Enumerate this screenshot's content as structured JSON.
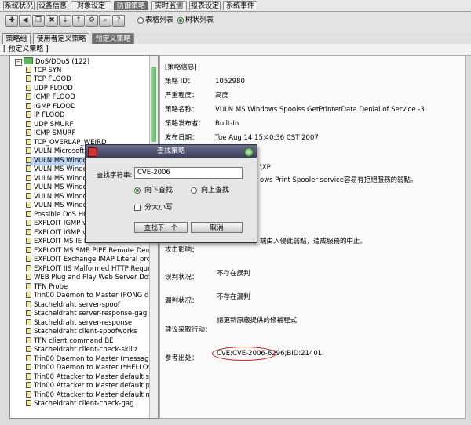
{
  "top_tabs": [
    "系统状况",
    "设备信息",
    "对象设定",
    "防御策略",
    "实时监测",
    "报表设定",
    "系统事件"
  ],
  "toolbar": {
    "view_options": [
      {
        "label": "表格列表",
        "selected": false
      },
      {
        "label": "树状列表",
        "selected": true
      }
    ]
  },
  "sub_tabs": [
    "策略组",
    "使用者定义策略",
    "预定义策略"
  ],
  "breadcrumb": "[ 预定义策略 ]",
  "tree": {
    "root_label": "DoS/DDoS (122)",
    "items": [
      "TCP SYN",
      "TCP FLOOD",
      "UDP FLOOD",
      "ICMP FLOOD",
      "IGMP FLOOD",
      "IP FLOOD",
      "UDP SMURF",
      "ICMP SMURF",
      "TCP_OVERLAP_WEIRD",
      "VULN Microsoft E",
      "VULN MS Window",
      "VULN MS Window",
      "VULN MS Window",
      "VULN MS Window",
      "VULN MS Window",
      "VULN MS Window",
      "Possible DoS HO",
      "EXPLOIT IGMP v3",
      "EXPLOIT IGMP v3",
      "EXPLOIT MS IE H",
      "EXPLOIT MS SMB PIPE Remote Denial o",
      "EXPLOIT Exchange IMAP Literal process",
      "EXPLOIT IIS Malformed HTTP Request R",
      "WEB Plug and Play Web Server DoS atte",
      "TFN Probe",
      "Trin00 Daemon to Master (PONG detecte",
      "Stacheldraht server-spoof",
      "Stacheldraht server-response-gag",
      "Stacheldraht server-response",
      "Stacheldraht client-spoofworks",
      "TFN client command BE",
      "Stacheldraht client-check-skillz",
      "Trin00 Daemon to Master (message dete",
      "Trin00 Daemon to Master (*HELLO* dete",
      "Trin00 Attacker to Master default startup p",
      "Trin00 Attacker to Master default passwo",
      "Trin00 Attacker to Master default mdie pa",
      "Stacheldraht client-check-gag"
    ],
    "highlighted_index": 10
  },
  "detail": {
    "section_title": "[策略信息]",
    "fields": [
      {
        "label": "策略 ID：",
        "value": "1052980"
      },
      {
        "label": "严重程度：",
        "value": "高度"
      },
      {
        "label": "策略名称：",
        "value": "VULN MS Windows Spoolss GetPrinterData Denial of Service -3"
      },
      {
        "label": "策略发布者：",
        "value": "Built-In"
      },
      {
        "label": "发布日期：",
        "value": "Tue Aug 14 15:40:36 CST 2007"
      }
    ],
    "partial_1": "\\XP",
    "partial_2": "ows Print Spooler service容易有拒絕服務的弱點。",
    "partial_3": "端由入侵此弱點，造成服務的中止。",
    "attack_label": "攻击影响：",
    "false_positive_label": "误判状况：",
    "false_positive_value": "不存在誤判",
    "missed_label": "漏判状况：",
    "missed_value": "不存在漏判",
    "action_label": "建议采取行动：",
    "action_value": "請更新原廠提供的修補程式",
    "reference_label": "参考出处：",
    "reference_value": "CVE:CVE-2006-6296;BID:21401;"
  },
  "dialog": {
    "title": "查找策略",
    "search_label": "查找字符串:",
    "search_value": "CVE-2006",
    "direction_options": [
      {
        "label": "向下查找",
        "selected": true
      },
      {
        "label": "向上查找",
        "selected": false
      }
    ],
    "case_label": "分大小写",
    "find_next_label": "查找下一个",
    "cancel_label": "取消"
  }
}
